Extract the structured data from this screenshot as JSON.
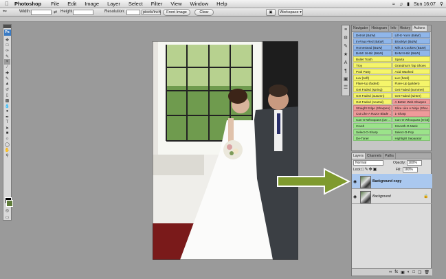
{
  "menubar": {
    "apple": "",
    "items": [
      "Photoshop",
      "File",
      "Edit",
      "Image",
      "Layer",
      "Select",
      "Filter",
      "View",
      "Window",
      "Help"
    ],
    "clock": "Sun 16:07"
  },
  "options": {
    "width_label": "Width:",
    "height_label": "Height:",
    "resolution_label": "Resolution:",
    "units_value": "pixels/inch",
    "front_image": "Front Image",
    "clear": "Clear",
    "workspace": "Workspace"
  },
  "toolbox": {
    "logo": "Ps"
  },
  "actions_panel": {
    "tabs": [
      "Navigator",
      "Histogram",
      "Info",
      "History",
      "Actions"
    ],
    "rows": [
      [
        {
          "t": "Detroit (B&W)",
          "c": "#8fb6ea"
        },
        {
          "t": "Lift-E-Yum! (B&W)",
          "c": "#8fb6ea"
        }
      ],
      [
        {
          "t": "In-Faux-Red (B&W)",
          "c": "#8fb6ea"
        },
        {
          "t": "Brooklyn (B&W)",
          "c": "#8fb6ea"
        }
      ],
      [
        {
          "t": "Homestead (B&W)",
          "c": "#8fb6ea"
        },
        {
          "t": "Milk & Cookies (B&W)",
          "c": "#8fb6ea"
        }
      ],
      [
        {
          "t": "BAM! 16-Bit (B&W)",
          "c": "#8fb6ea"
        },
        {
          "t": "BAM! 8-Bit (B&W)",
          "c": "#8fb6ea"
        }
      ],
      [
        {
          "t": "Bullet Tooth",
          "c": "#f5f56a"
        },
        {
          "t": "Sparta",
          "c": "#f5f56a"
        }
      ],
      [
        {
          "t": "Troy",
          "c": "#f5f56a"
        },
        {
          "t": "Grandma's Tap Shoes",
          "c": "#f5f56a"
        }
      ],
      [
        {
          "t": "Pool Party",
          "c": "#f5f56a"
        },
        {
          "t": "Acid Washed",
          "c": "#f5f56a"
        }
      ],
      [
        {
          "t": "Luv (soft)",
          "c": "#f5f56a"
        },
        {
          "t": "Luv (hard)",
          "c": "#f5f56a"
        }
      ],
      [
        {
          "t": "Flare-Up (faded)",
          "c": "#f5f56a"
        },
        {
          "t": "Flare-Up (golden)",
          "c": "#f5f56a"
        }
      ],
      [
        {
          "t": "Get Faded (spring)",
          "c": "#f5f56a"
        },
        {
          "t": "Get Faded (summer)",
          "c": "#f5f56a"
        }
      ],
      [
        {
          "t": "Get Faded (autumn)",
          "c": "#f5f56a"
        },
        {
          "t": "Get Faded (winter)",
          "c": "#f5f56a"
        }
      ],
      [
        {
          "t": "Get Faded (neutral)",
          "c": "#f5f56a"
        },
        {
          "t": "A Better Web Sharpen",
          "c": "#ef9a9a"
        }
      ],
      [
        {
          "t": "Straight Edge (Sharpen)",
          "c": "#ef9a9a"
        },
        {
          "t": "Slice Like A Ninja (Shar...",
          "c": "#ef9a9a"
        }
      ],
      [
        {
          "t": "Cut Like A Razor Blade ...",
          "c": "#ef9a9a"
        },
        {
          "t": "1-Sharp",
          "c": "#ef9a9a"
        }
      ],
      [
        {
          "t": "Can-O-Whoopass (16-...",
          "c": "#9be38a"
        },
        {
          "t": "Can-O-Whoopass (8-bit)",
          "c": "#9be38a"
        }
      ],
      [
        {
          "t": "Crush",
          "c": "#9be38a"
        },
        {
          "t": "Smooth-O-Matic",
          "c": "#9be38a"
        }
      ],
      [
        {
          "t": "Select-O-Sharp",
          "c": "#9be38a"
        },
        {
          "t": "Select-O-Pop",
          "c": "#9be38a"
        }
      ],
      [
        {
          "t": "De-Toner",
          "c": "#9be38a"
        },
        {
          "t": "Highlight Separator",
          "c": "#9be38a"
        }
      ]
    ]
  },
  "layers_panel": {
    "tabs": [
      "Layers",
      "Channels",
      "Paths"
    ],
    "blend_mode": "Normal",
    "opacity_label": "Opacity:",
    "opacity_value": "100%",
    "lock_label": "Lock:",
    "fill_label": "Fill:",
    "fill_value": "100%",
    "layers": [
      {
        "name": "Background copy",
        "selected": true
      },
      {
        "name": "Background",
        "selected": false
      }
    ]
  },
  "annotation": {
    "arrow_color": "#7f9a2e"
  }
}
